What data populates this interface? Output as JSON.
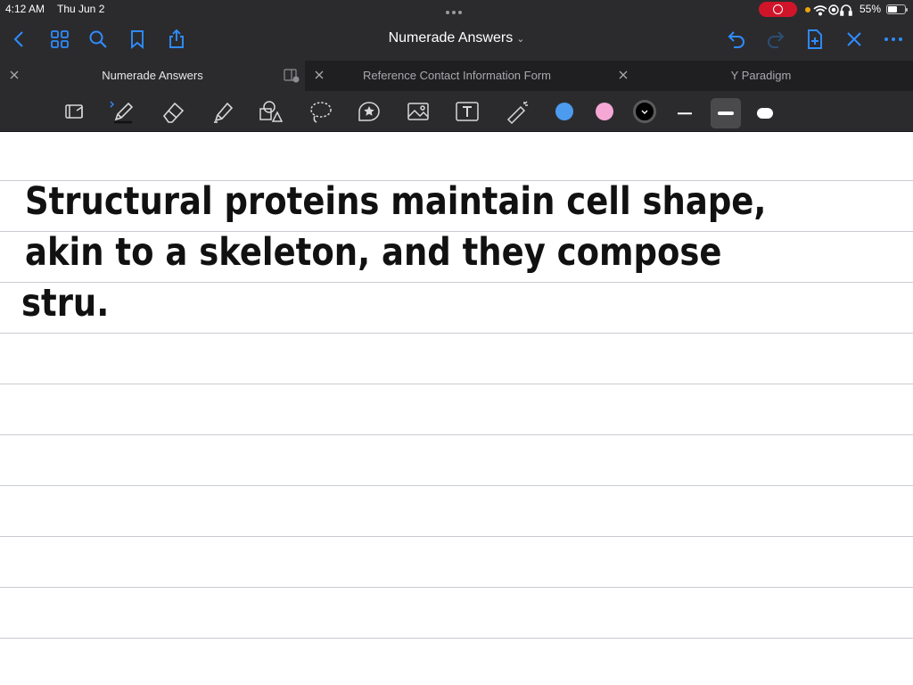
{
  "status_bar": {
    "time": "4:12 AM",
    "date": "Thu Jun 2",
    "battery_percent": "55%",
    "battery_level": 0.55,
    "icons": [
      "recording-icon",
      "orange-dot-icon",
      "wifi-icon",
      "location-icon",
      "headphones-icon",
      "battery-icon"
    ]
  },
  "nav_bar": {
    "document_title": "Numerade Answers",
    "left_icons": [
      "back-icon",
      "grid-icon",
      "search-icon",
      "bookmark-icon",
      "share-icon"
    ],
    "right_icons": [
      "undo-icon",
      "redo-icon",
      "add-page-icon",
      "close-pen-icon",
      "more-icon"
    ]
  },
  "tabs": [
    {
      "label": "Numerade Answers",
      "active": true
    },
    {
      "label": "Reference Contact Information Form",
      "active": false
    },
    {
      "label": "Y Paradigm",
      "active": false
    }
  ],
  "toolbar": {
    "tools": [
      "read-only-icon",
      "pen-icon",
      "eraser-icon",
      "highlighter-icon",
      "shapes-icon",
      "lasso-icon",
      "sticker-icon",
      "image-icon",
      "text-icon",
      "laser-pointer-icon"
    ],
    "colors": [
      "#4c9bef",
      "#f5a7d6",
      "#000000"
    ],
    "selected_color": "#000000",
    "stroke_sizes": [
      "thin",
      "medium",
      "thick"
    ],
    "selected_stroke": "medium"
  },
  "notes": {
    "lines": [
      "Structural proteins maintain cell shape,",
      "akin to a skeleton, and they compose",
      "stru."
    ]
  }
}
